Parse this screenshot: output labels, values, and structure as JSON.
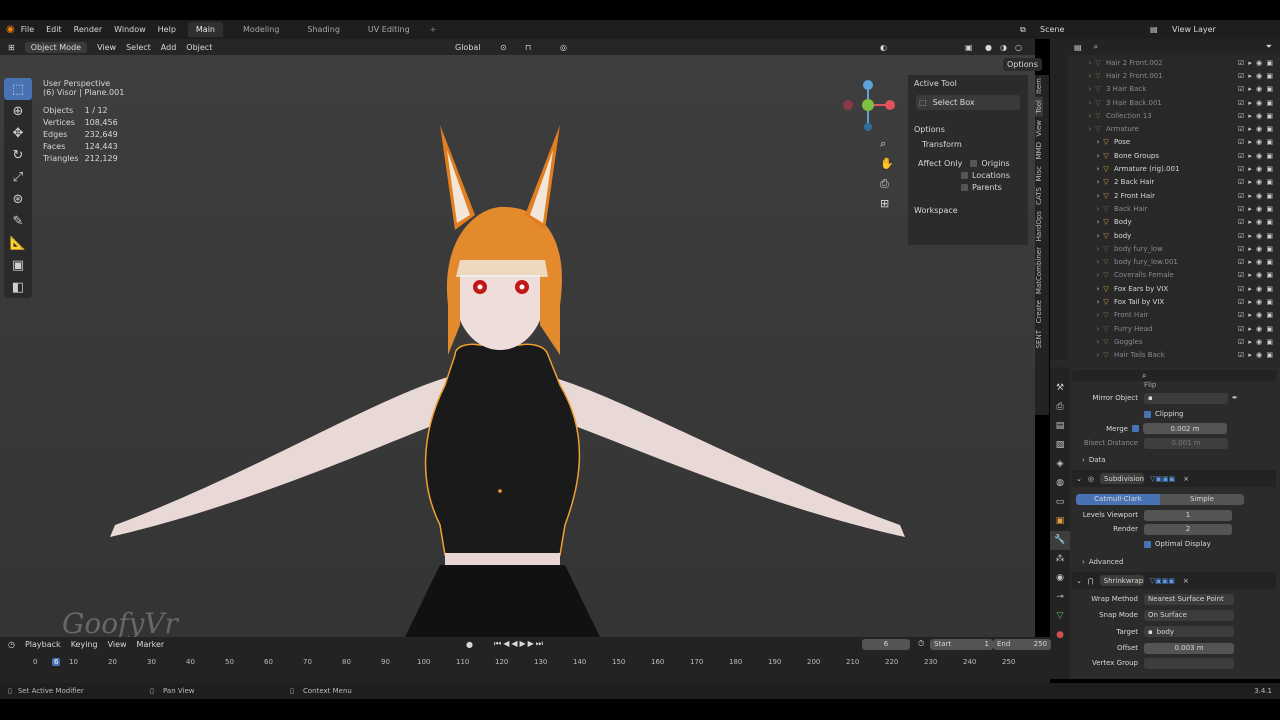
{
  "menubar": {
    "items": [
      "File",
      "Edit",
      "Render",
      "Window",
      "Help"
    ],
    "tabs": [
      "Main",
      "Modeling",
      "Shading",
      "UV Editing"
    ],
    "scene": "Scene",
    "view_layer": "View Layer"
  },
  "viewport_header": {
    "mode": "Object Mode",
    "menus": [
      "View",
      "Select",
      "Add",
      "Object"
    ],
    "transform": "Global",
    "options": "Options"
  },
  "viewport_info": {
    "perspective": "User Perspective",
    "active": "(6) Visor | Plane.001",
    "stats": [
      {
        "label": "Objects",
        "value": "1 / 12"
      },
      {
        "label": "Vertices",
        "value": "108,456"
      },
      {
        "label": "Edges",
        "value": "232,649"
      },
      {
        "label": "Faces",
        "value": "124,443"
      },
      {
        "label": "Triangles",
        "value": "212,129"
      }
    ],
    "watermark": "GoofyVr"
  },
  "npanel": {
    "active_tool": "Active Tool",
    "select_box": "Select Box",
    "options": "Options",
    "transform": "Transform",
    "affect_only": "Affect Only",
    "origins": "Origins",
    "locations": "Locations",
    "parents": "Parents",
    "workspace": "Workspace"
  },
  "vertical_tabs": [
    "Item",
    "Tool",
    "View",
    "MMD",
    "Misc",
    "CATS",
    "HardOps",
    "MatCombiner",
    "Create",
    "SENT"
  ],
  "outliner": {
    "rows": [
      {
        "name": "Hair 2 Front.002",
        "dim": true,
        "indent": 1
      },
      {
        "name": "Hair 2 Front.001",
        "dim": true,
        "indent": 1
      },
      {
        "name": "3 Hair Back",
        "dim": true,
        "indent": 1
      },
      {
        "name": "3 Hair Back.001",
        "dim": true,
        "indent": 1
      },
      {
        "name": "Collection 13",
        "dim": true,
        "indent": 1
      },
      {
        "name": "Armature",
        "dim": true,
        "indent": 1
      },
      {
        "name": "Pose",
        "dim": false,
        "indent": 2
      },
      {
        "name": "Bone Groups",
        "dim": false,
        "indent": 2
      },
      {
        "name": "Armature (rig).001",
        "dim": false,
        "indent": 2
      },
      {
        "name": "2 Back Hair",
        "dim": false,
        "indent": 2
      },
      {
        "name": "2 Front Hair",
        "dim": false,
        "indent": 2
      },
      {
        "name": "Back Hair",
        "dim": true,
        "indent": 2
      },
      {
        "name": "Body",
        "dim": false,
        "indent": 2
      },
      {
        "name": "body",
        "dim": false,
        "indent": 2
      },
      {
        "name": "body fury_low",
        "dim": true,
        "indent": 2
      },
      {
        "name": "body fury_low.001",
        "dim": true,
        "indent": 2
      },
      {
        "name": "Coveralls Female",
        "dim": true,
        "indent": 2
      },
      {
        "name": "Fox Ears by VIX",
        "dim": false,
        "indent": 2
      },
      {
        "name": "Fox Tail by VIX",
        "dim": false,
        "indent": 2
      },
      {
        "name": "Front Hair",
        "dim": true,
        "indent": 2
      },
      {
        "name": "Furry Head",
        "dim": true,
        "indent": 2
      },
      {
        "name": "Goggles",
        "dim": true,
        "indent": 2
      },
      {
        "name": "Hair Tails Back",
        "dim": true,
        "indent": 2
      }
    ]
  },
  "properties": {
    "flip_label": "Flip",
    "mirror_object": "Mirror Object",
    "clipping": "Clipping",
    "merge_label": "Merge",
    "merge_value": "0.002 m",
    "bisect_label": "Bisect Distance",
    "bisect_value": "0.001 m",
    "data": "Data",
    "subdivision_name": "Subdivision",
    "catmull": "Catmull-Clark",
    "simple": "Simple",
    "levels_viewport_label": "Levels Viewport",
    "levels_viewport": "1",
    "render_label": "Render",
    "render_value": "2",
    "optimal_display": "Optimal Display",
    "advanced": "Advanced",
    "shrinkwrap_name": "Shrinkwrap",
    "wrap_method_label": "Wrap Method",
    "wrap_method": "Nearest Surface Point",
    "snap_mode_label": "Snap Mode",
    "snap_mode": "On Surface",
    "target_label": "Target",
    "target": "body",
    "offset_label": "Offset",
    "offset": "0.003 m",
    "vertex_group_label": "Vertex Group"
  },
  "timeline": {
    "menus": [
      "Playback",
      "Keying",
      "View",
      "Marker"
    ],
    "current_frame": "6",
    "start_label": "Start",
    "start": "1",
    "end_label": "End",
    "end": "250",
    "ticks": [
      "0",
      "6",
      "10",
      "20",
      "30",
      "40",
      "50",
      "60",
      "70",
      "80",
      "90",
      "100",
      "110",
      "120",
      "130",
      "140",
      "150",
      "160",
      "170",
      "180",
      "190",
      "200",
      "210",
      "220",
      "230",
      "240",
      "250"
    ]
  },
  "status_bar": {
    "left": "Set Active Modifier",
    "mid": "Pan View",
    "right": "Context Menu",
    "version": "3.4.1"
  },
  "colors": {
    "accent": "#4772b3",
    "bg_panel": "#282828",
    "viewport": "#3a3a3a",
    "selection": "#f0a030"
  }
}
